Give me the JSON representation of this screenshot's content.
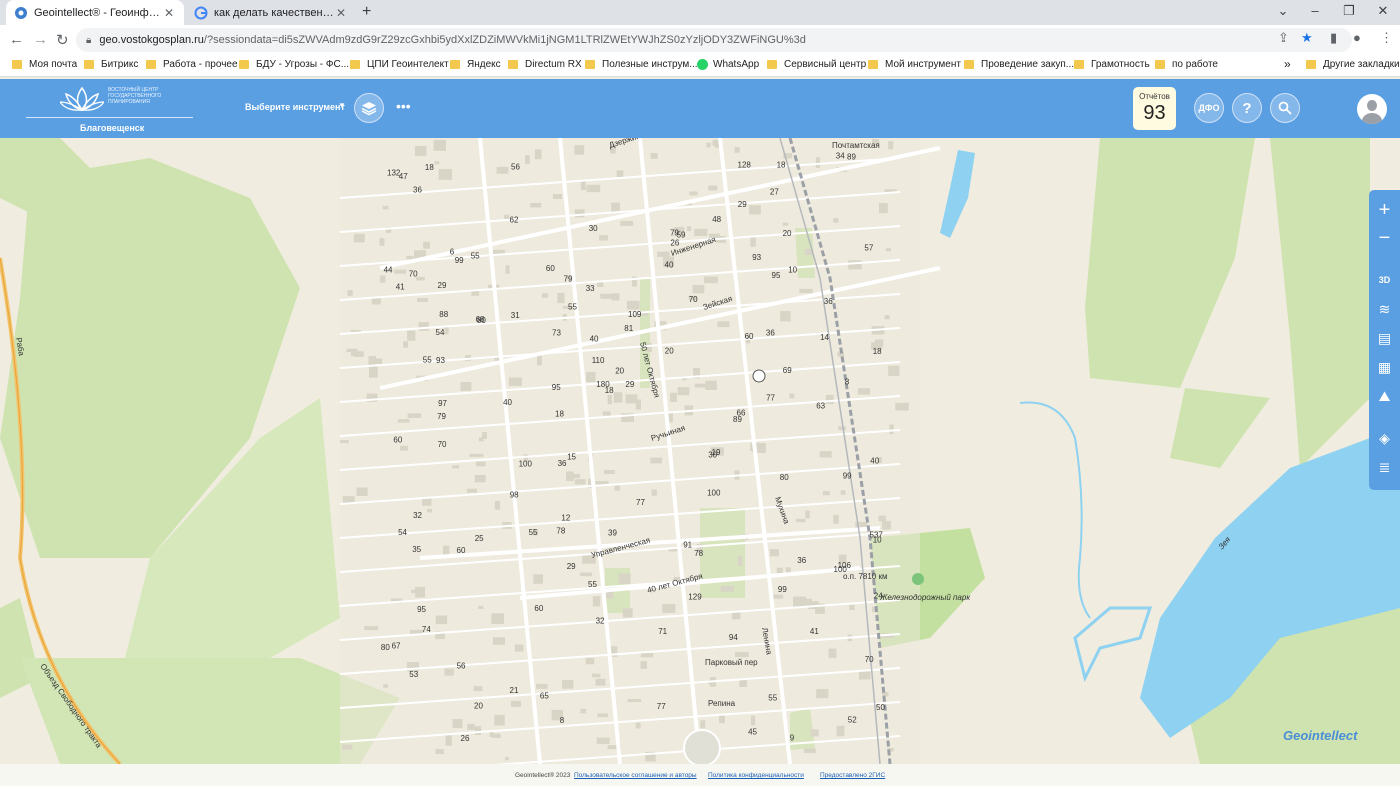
{
  "browser": {
    "tabs": [
      {
        "title": "Geointellect® - Геоинформацио",
        "active": true
      },
      {
        "title": "как делать качественные снимок",
        "active": false
      }
    ],
    "new_tab": "+",
    "url_host": "geo.vostokgosplan.ru",
    "url_path": "/?sessiondata=di5sZWVAdm9zdG9rZ29zcGxhbi5ydXxlZDZiMWVkMi1jNGM1LTRlZWEtYWJhZS0zYzljODY3ZWFiNGU%3d",
    "bookmarks": [
      {
        "label": "Моя почта",
        "icon": "folder-icon"
      },
      {
        "label": "Битрикс",
        "icon": "folder-icon"
      },
      {
        "label": "Работа - прочее",
        "icon": "folder-icon"
      },
      {
        "label": "БДУ - Угрозы - ФС...",
        "icon": "folder-icon"
      },
      {
        "label": "ЦПИ Геоинтелект",
        "icon": "folder-icon"
      },
      {
        "label": "Яндекс",
        "icon": "folder-icon"
      },
      {
        "label": "Directum RX",
        "icon": "folder-icon"
      },
      {
        "label": "Полезные инструм...",
        "icon": "folder-icon"
      },
      {
        "label": "WhatsApp",
        "icon": "whatsapp-icon"
      },
      {
        "label": "Сервисный центр",
        "icon": "folder-icon"
      },
      {
        "label": "Мой инструмент",
        "icon": "folder-icon"
      },
      {
        "label": "Проведение закуп...",
        "icon": "folder-icon"
      },
      {
        "label": "Грамотность",
        "icon": "folder-icon"
      },
      {
        "label": "по работе",
        "icon": "folder-icon"
      }
    ],
    "overflow": "»",
    "other_bookmarks": "Другие закладки"
  },
  "app": {
    "logo_text": "ВОСТОЧНЫЙ ЦЕНТР ГОСУДАРСТВЕННОГО ПЛАНИРОВАНИЯ",
    "city": "Благовещенск",
    "tool_select": "Выберите инструмент",
    "reports_label": "Отчётов",
    "reports_count": "93",
    "dfo_label": "ДФО",
    "help_label": "?",
    "colors": {
      "header": "#5b9fe3",
      "water": "#8ed1f0",
      "park": "#c4e0a0",
      "forest": "#cfe3b0"
    }
  },
  "map": {
    "street_labels": [
      "Дзержинского",
      "Почтамтская",
      "Инженерная",
      "50 лет Октября",
      "Зейская",
      "Ручьиная",
      "Управленческая",
      "40 лет Октября",
      "Мухина",
      "Парковый пер",
      "Репина",
      "Ленина",
      "Железнодорожный парк",
      "о.п. 7810 км",
      "Зея",
      "Объезд Свободного тракта",
      "Раба"
    ],
    "house_numbers": [
      "18",
      "77",
      "80",
      "36",
      "39",
      "55",
      "74",
      "78",
      "93",
      "128",
      "99",
      "54",
      "29",
      "88",
      "10",
      "129",
      "100",
      "99",
      "77",
      "45",
      "25",
      "62",
      "94",
      "54",
      "32",
      "63",
      "67",
      "60",
      "59",
      "98",
      "65",
      "80",
      "56",
      "180",
      "44",
      "47",
      "40",
      "79",
      "40",
      "55",
      "91",
      "93",
      "29",
      "53",
      "57",
      "40",
      "70",
      "99",
      "68",
      "52",
      "24",
      "106",
      "60",
      "10",
      "95",
      "48",
      "70",
      "80",
      "55",
      "27",
      "41",
      "34",
      "26",
      "109",
      "20",
      "89",
      "60",
      "73",
      "81",
      "35",
      "66",
      "56",
      "36",
      "78",
      "8",
      "29",
      "110",
      "79",
      "132",
      "32",
      "41",
      "18",
      "18",
      "8",
      "89",
      "40",
      "30",
      "14",
      "36",
      "15",
      "31",
      "21",
      "55",
      "33",
      "60",
      "70",
      "19",
      "70",
      "20",
      "18",
      "18",
      "9",
      "69",
      "26",
      "29",
      "12",
      "55",
      "60",
      "36",
      "71",
      "6",
      "97",
      "100",
      "95",
      "537",
      "20",
      "30",
      "100",
      "79",
      "55",
      "95",
      "20",
      "50",
      "77",
      "36"
    ]
  },
  "map_tools": {
    "zoom_in": "+",
    "zoom_out": "−",
    "mode_3d": "3D"
  },
  "brand": "Geointellect",
  "footer": {
    "copyright": "Geointellect® 2023",
    "agreement": "Пользовательское соглашение и авторы",
    "privacy": "Политика конфиденциальности",
    "provider": "Предоставлено 2ГИС"
  }
}
